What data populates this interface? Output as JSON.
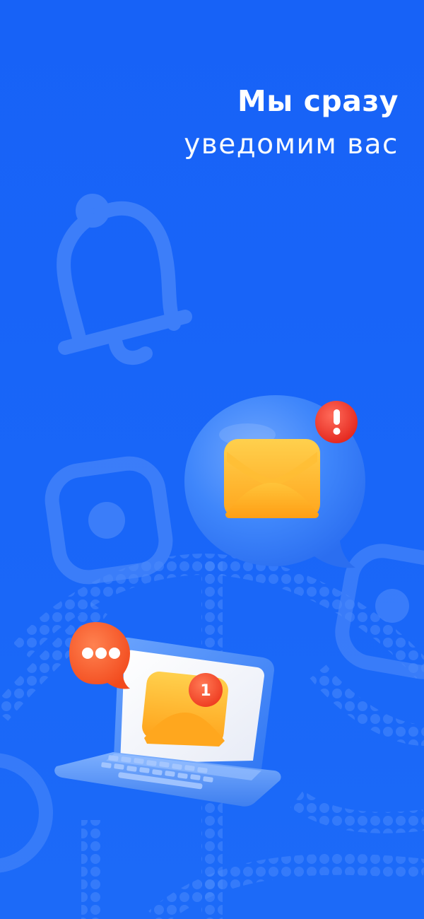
{
  "headline": {
    "line1": "Мы сразу",
    "line2": "уведомим вас"
  },
  "laptop_mail_badge": "1",
  "colors": {
    "background": "#1966f8",
    "text": "#ffffff",
    "alert_red": "#f1342c",
    "envelope_yellow": "#ffb62e",
    "chat_orange": "#ff5a2a",
    "bubble_blue": "#3f86fb"
  },
  "icons": [
    "bell-icon",
    "square-icon",
    "envelope-icon",
    "alert-badge-icon",
    "laptop-icon",
    "chat-bubble-icon"
  ]
}
